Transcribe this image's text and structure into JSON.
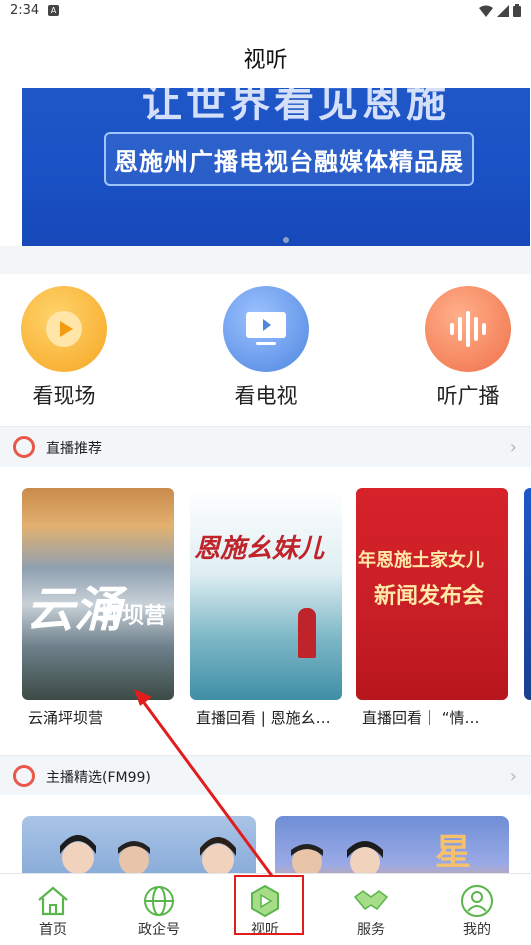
{
  "status": {
    "time": "2:34",
    "notif_badge": "A"
  },
  "header": {
    "title": "视听"
  },
  "banner": {
    "headline_partial": "让世界看见恩施",
    "subtitle": "恩施州广播电视台融媒体精品展"
  },
  "quick_actions": [
    {
      "label": "看现场",
      "icon": "play-icon",
      "color": "#f6a623"
    },
    {
      "label": "看电视",
      "icon": "tv-icon",
      "color": "#4f86e0"
    },
    {
      "label": "听广播",
      "icon": "audio-wave-icon",
      "color": "#f0704a"
    }
  ],
  "live_section": {
    "title": "直播推荐",
    "cards": [
      {
        "label": "云涌坪坝营",
        "overlay_big": "云涌",
        "overlay_small": "坪坝营"
      },
      {
        "label": "直播回看 | 恩施幺妹儿",
        "overlay": "恩施幺妹儿"
      },
      {
        "label": "直播回看｜ “情…",
        "overlay_line1": "年恩施土家女儿",
        "overlay_line2": "新闻发布会"
      }
    ]
  },
  "anchor_section": {
    "title": "主播精选(FM99)"
  },
  "tabbar": {
    "items": [
      {
        "label": "首页",
        "icon": "home-icon"
      },
      {
        "label": "政企号",
        "icon": "globe-icon"
      },
      {
        "label": "视听",
        "icon": "video-play-icon"
      },
      {
        "label": "服务",
        "icon": "handshake-icon"
      },
      {
        "label": "我的",
        "icon": "user-icon"
      }
    ]
  },
  "colors": {
    "accent_green": "#5ab54b",
    "highlight_red": "#e21c1c",
    "section_ring": "#e8574a"
  }
}
